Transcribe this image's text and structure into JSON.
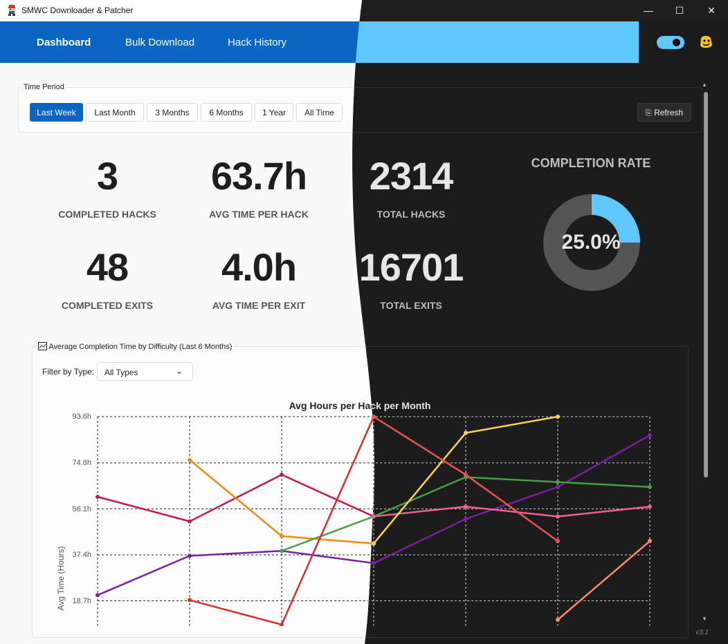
{
  "window": {
    "title": "SMWC Downloader & Patcher",
    "minimize_glyph": "—",
    "maximize_glyph": "☐",
    "close_glyph": "✕"
  },
  "nav": {
    "tabs": [
      {
        "label": "Dashboard",
        "active": true
      },
      {
        "label": "Bulk Download",
        "active": false
      },
      {
        "label": "Hack History",
        "active": false
      }
    ],
    "theme_toggle_on": true
  },
  "time_period": {
    "legend": "Time Period",
    "buttons": [
      "Last Week",
      "Last Month",
      "3 Months",
      "6 Months",
      "1 Year",
      "All Time"
    ],
    "active": "Last Week",
    "refresh_label": "Refresh",
    "refresh_icon": "⎘"
  },
  "stats": {
    "completed_hacks": {
      "value": "3",
      "label": "COMPLETED HACKS"
    },
    "avg_time_per_hack": {
      "value": "63.7h",
      "label": "AVG TIME PER HACK"
    },
    "total_hacks": {
      "value": "2314",
      "label": "TOTAL HACKS"
    },
    "completed_exits": {
      "value": "48",
      "label": "COMPLETED EXITS"
    },
    "avg_time_per_exit": {
      "value": "4.0h",
      "label": "AVG TIME PER EXIT"
    },
    "total_exits": {
      "value": "16701",
      "label": "TOTAL EXITS"
    }
  },
  "completion_rate": {
    "title": "COMPLETION RATE",
    "value": 0.25,
    "text": "25.0%"
  },
  "difficulty_section": {
    "legend": "Average Completion Time by Difficulty (Last 6 Months)",
    "icon": "chart-icon",
    "filter_label": "Filter by Type:",
    "filter_value": "All Types",
    "filter_chevron": "⌄"
  },
  "chart_data": {
    "type": "line",
    "title": "Avg Hours per Hack per Month",
    "ylabel": "Avg Time (Hours)",
    "y_ticks": [
      "18.7h",
      "37.4h",
      "56.1h",
      "74.8h",
      "93.6h"
    ],
    "y_tick_values": [
      18.7,
      37.4,
      56.1,
      74.8,
      93.6
    ],
    "ylim": [
      0,
      93.6
    ],
    "x_count": 7,
    "grid": true,
    "series": [
      {
        "color": "#c2185b",
        "values": [
          61,
          51,
          70,
          53,
          null,
          null,
          null
        ]
      },
      {
        "color": "#ef8b14",
        "values": [
          null,
          76,
          45,
          42,
          null,
          null,
          null
        ]
      },
      {
        "color": "#7b1fa2",
        "values": [
          21,
          37,
          39,
          34,
          52,
          65,
          86
        ]
      },
      {
        "color": "#43a047",
        "values": [
          null,
          null,
          39,
          53,
          69,
          67,
          65
        ]
      },
      {
        "color": "#d32f2f",
        "values": [
          null,
          19,
          9,
          93.6,
          null,
          null,
          null
        ]
      },
      {
        "color": "#f06292",
        "values": [
          null,
          null,
          null,
          53,
          57,
          53,
          57
        ]
      },
      {
        "color": "#ffd54f",
        "values": [
          null,
          null,
          null,
          42,
          87,
          93.6,
          null
        ]
      },
      {
        "color": "#ef5350",
        "values": [
          null,
          null,
          null,
          93.6,
          70,
          43,
          null
        ]
      },
      {
        "color": "#ff8a65",
        "values": [
          null,
          null,
          null,
          null,
          null,
          11,
          43
        ]
      }
    ]
  },
  "scrollbar": {
    "up": "▲",
    "down": "▼"
  },
  "version": "v3.1"
}
